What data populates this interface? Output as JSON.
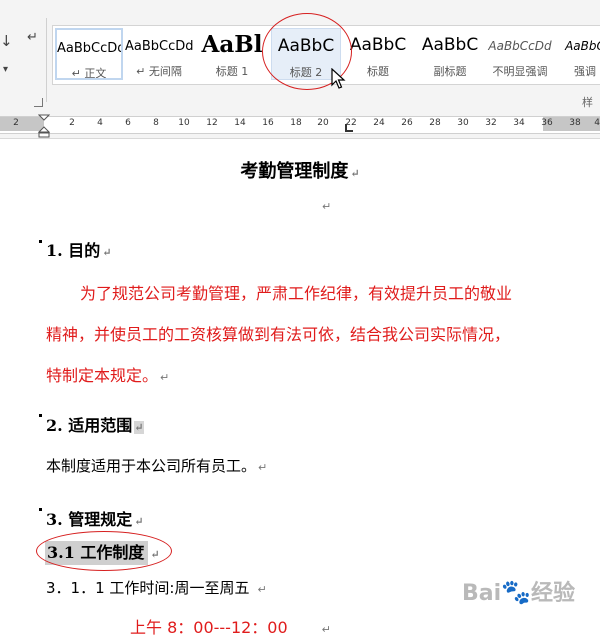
{
  "ribbon": {
    "styles": [
      {
        "preview": "AaBbCcDd",
        "label": "↵ 正文",
        "preview_size": 13,
        "bold": false,
        "italic": false
      },
      {
        "preview": "AaBbCcDd",
        "label": "↵ 无间隔",
        "preview_size": 13,
        "bold": false,
        "italic": false
      },
      {
        "preview": "AaBl",
        "label": "标题 1",
        "preview_size": 23,
        "bold": true,
        "italic": false
      },
      {
        "preview": "AaBbC",
        "label": "标题 2",
        "preview_size": 17,
        "bold": false,
        "italic": false
      },
      {
        "preview": "AaBbC",
        "label": "标题",
        "preview_size": 17,
        "bold": false,
        "italic": false
      },
      {
        "preview": "AaBbC",
        "label": "副标题",
        "preview_size": 17,
        "bold": false,
        "italic": false
      },
      {
        "preview": "AaBbCcDd",
        "label": "不明显强调",
        "preview_size": 12,
        "bold": false,
        "italic": true
      },
      {
        "preview": "AaBbC",
        "label": "强调",
        "preview_size": 12,
        "bold": false,
        "italic": true
      }
    ],
    "group_label": "样式"
  },
  "ruler": {
    "numbers": [
      "2",
      "2",
      "4",
      "6",
      "8",
      "10",
      "12",
      "14",
      "16",
      "18",
      "20",
      "22",
      "24",
      "26",
      "28",
      "30",
      "32",
      "34",
      "36",
      "38",
      "40"
    ]
  },
  "document": {
    "title": "考勤管理制度",
    "sections": [
      {
        "heading": "1.  目的"
      },
      {
        "heading": "2.  适用范围"
      },
      {
        "heading": "3.  管理规定"
      }
    ],
    "purpose_lines": [
      "为了规范公司考勤管理，严肃工作纪律，有效提升员工的敬业",
      "精神，并使员工的工资核算做到有法可依，结合我公司实际情况，",
      "特制定本规定。"
    ],
    "scope_text": "本制度适用于本公司所有员工。",
    "subheading": "3.1 工作制度",
    "work_time": "3．1．1 工作时间:周一至周五",
    "morning_hours": "上午  8：00---12：00"
  },
  "watermark": {
    "logo": "Bai",
    "suffix": "经验"
  },
  "colors": {
    "red_text": "#e01c1c",
    "annotation": "#d62020",
    "highlight": "#cfcfcf"
  }
}
